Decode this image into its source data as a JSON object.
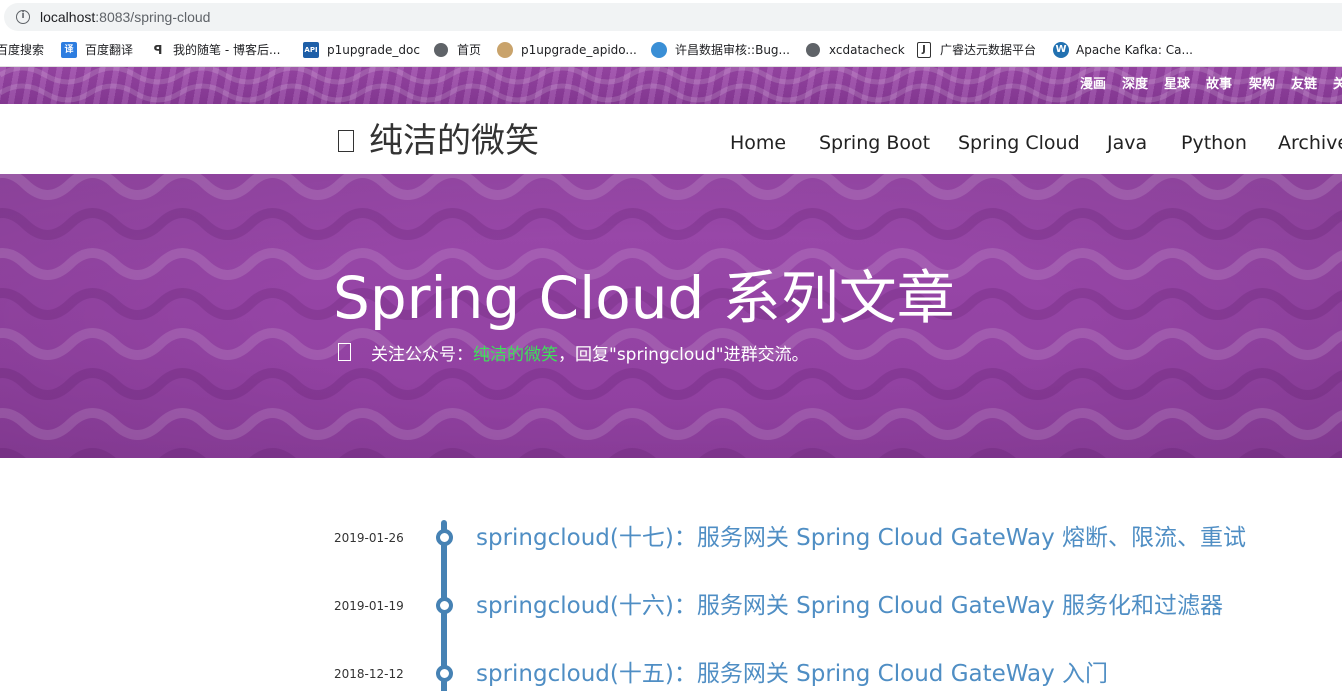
{
  "browser": {
    "url_host": "localhost",
    "url_path": ":8083/spring-cloud"
  },
  "bookmarks": [
    {
      "label": "百度搜索",
      "icon": "baidu-icon"
    },
    {
      "label": "百度翻译",
      "icon": "translate-icon"
    },
    {
      "label": "我的随笔 - 博客后...",
      "icon": "cnblogs-icon"
    },
    {
      "label": "p1upgrade_doc",
      "icon": "api-icon"
    },
    {
      "label": "首页",
      "icon": "globe-icon"
    },
    {
      "label": "p1upgrade_apido...",
      "icon": "user-icon"
    },
    {
      "label": "许昌数据审核::Bug...",
      "icon": "earth-icon"
    },
    {
      "label": "xcdatacheck",
      "icon": "globe-icon"
    },
    {
      "label": "广睿达元数据平台",
      "icon": "j-icon"
    },
    {
      "label": "Apache Kafka: Ca...",
      "icon": "wordpress-icon"
    }
  ],
  "topnav": [
    "漫画",
    "深度",
    "星球",
    "故事",
    "架构",
    "友链",
    "关"
  ],
  "site": {
    "brand": "纯洁的微笑",
    "nav": [
      "Home",
      "Spring Boot",
      "Spring Cloud",
      "Java",
      "Python",
      "Archive"
    ]
  },
  "hero": {
    "title": "Spring Cloud 系列文章",
    "sub_prefix": "关注公众号：",
    "sub_accent": "纯洁的微笑",
    "sub_suffix": "，回复\"springcloud\"进群交流。"
  },
  "posts": [
    {
      "date": "2019-01-26",
      "title": "springcloud(十七)：服务网关 Spring Cloud GateWay 熔断、限流、重试"
    },
    {
      "date": "2019-01-19",
      "title": "springcloud(十六)：服务网关 Spring Cloud GateWay 服务化和过滤器"
    },
    {
      "date": "2018-12-12",
      "title": "springcloud(十五)：服务网关 Spring Cloud GateWay 入门"
    }
  ],
  "colors": {
    "hero_purple": "#9a49aa",
    "timeline_blue": "#4682b4",
    "link_blue": "#4f8ec4",
    "accent_green": "#3ee05a"
  }
}
